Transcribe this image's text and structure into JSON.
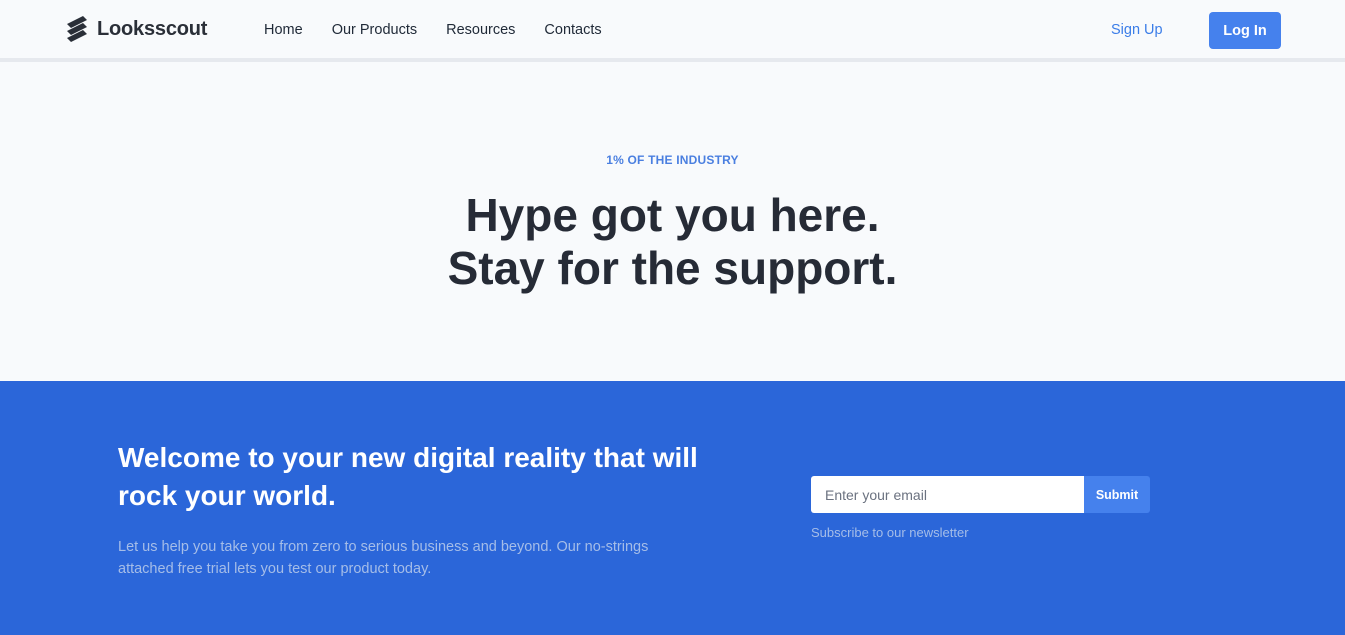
{
  "brand": {
    "name": "Looksscout",
    "logo_icon": "stacked-bars-logo-icon"
  },
  "nav": {
    "links": [
      "Home",
      "Our Products",
      "Resources",
      "Contacts"
    ],
    "signup_label": "Sign Up",
    "login_label": "Log In"
  },
  "hero": {
    "eyebrow": "1% OF THE INDUSTRY",
    "headline_line1": "Hype got you here.",
    "headline_line2": "Stay for the support."
  },
  "cta": {
    "title": "Welcome to your new digital reality that will rock your world.",
    "description": "Let us help you take you from zero to serious business and beyond. Our no-strings attached free trial lets you test our product today.",
    "email_placeholder": "Enter your email",
    "submit_label": "Submit",
    "hint": "Subscribe to our newsletter"
  },
  "colors": {
    "accent": "#4581ed",
    "cta_background": "#2b66d9",
    "page_background": "#f8fafc",
    "text_dark": "#262b36"
  }
}
